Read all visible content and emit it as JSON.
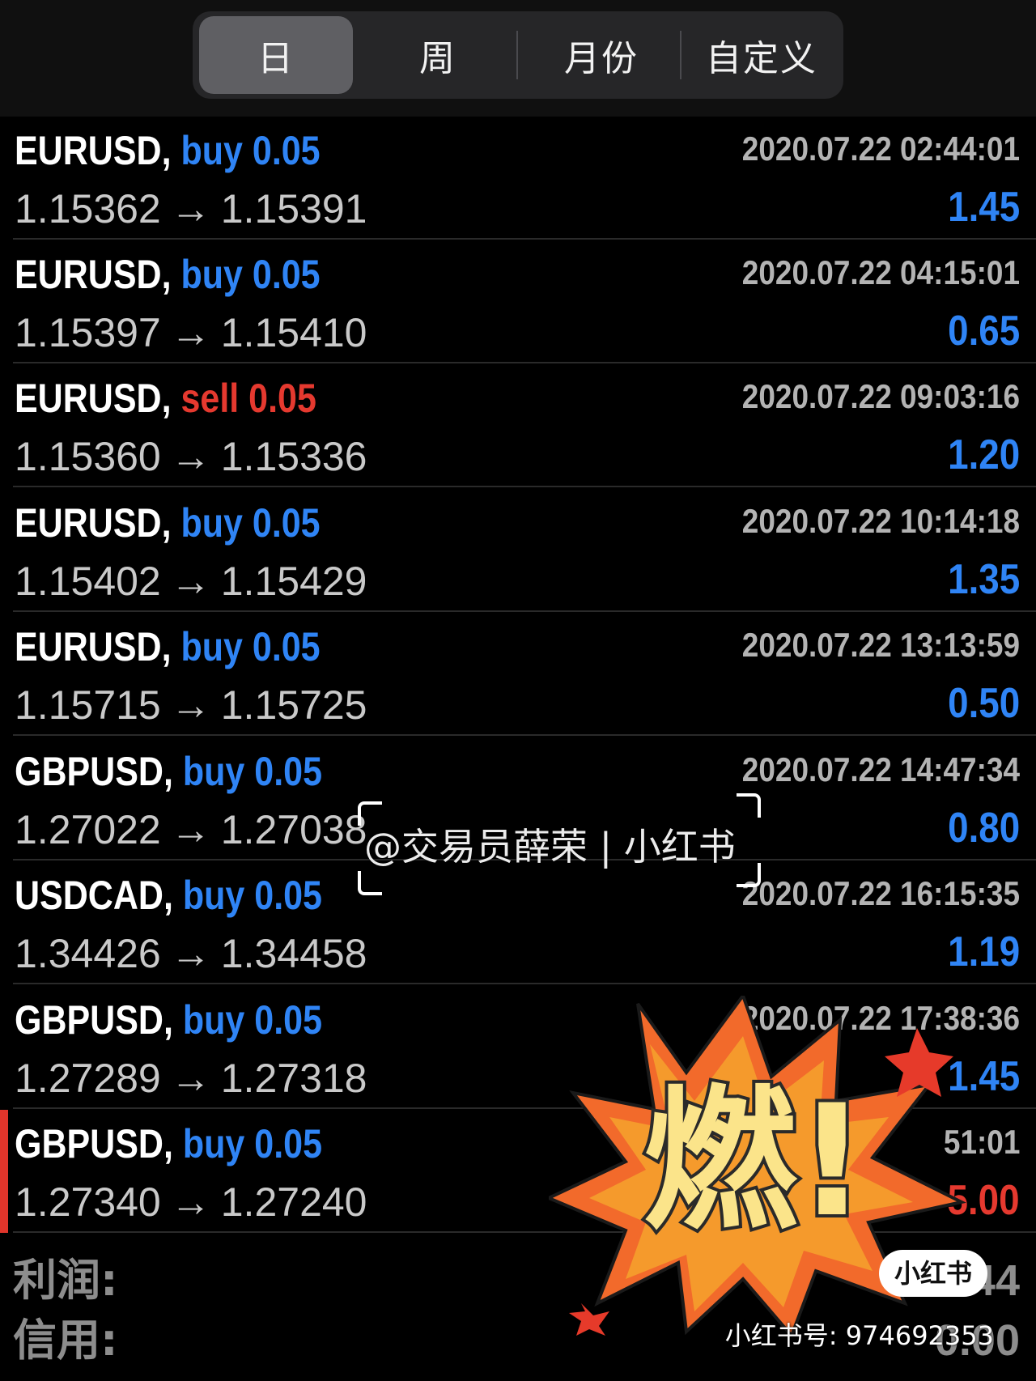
{
  "tabs": [
    {
      "label": "日",
      "active": true
    },
    {
      "label": "周",
      "active": false
    },
    {
      "label": "月份",
      "active": false
    },
    {
      "label": "自定义",
      "active": false
    }
  ],
  "trades": [
    {
      "symbol": "EURUSD",
      "side": "buy",
      "volume": "0.05",
      "open_price": "1.15362",
      "close_price": "1.15391",
      "time": "2020.07.22 02:44:01",
      "profit": "1.45"
    },
    {
      "symbol": "EURUSD",
      "side": "buy",
      "volume": "0.05",
      "open_price": "1.15397",
      "close_price": "1.15410",
      "time": "2020.07.22 04:15:01",
      "profit": "0.65"
    },
    {
      "symbol": "EURUSD",
      "side": "sell",
      "volume": "0.05",
      "open_price": "1.15360",
      "close_price": "1.15336",
      "time": "2020.07.22 09:03:16",
      "profit": "1.20"
    },
    {
      "symbol": "EURUSD",
      "side": "buy",
      "volume": "0.05",
      "open_price": "1.15402",
      "close_price": "1.15429",
      "time": "2020.07.22 10:14:18",
      "profit": "1.35"
    },
    {
      "symbol": "EURUSD",
      "side": "buy",
      "volume": "0.05",
      "open_price": "1.15715",
      "close_price": "1.15725",
      "time": "2020.07.22 13:13:59",
      "profit": "0.50"
    },
    {
      "symbol": "GBPUSD",
      "side": "buy",
      "volume": "0.05",
      "open_price": "1.27022",
      "close_price": "1.27038",
      "time": "2020.07.22 14:47:34",
      "profit": "0.80"
    },
    {
      "symbol": "USDCAD",
      "side": "buy",
      "volume": "0.05",
      "open_price": "1.34426",
      "close_price": "1.34458",
      "time": "2020.07.22 16:15:35",
      "profit": "1.19"
    },
    {
      "symbol": "GBPUSD",
      "side": "buy",
      "volume": "0.05",
      "open_price": "1.27289",
      "close_price": "1.27318",
      "time": "2020.07.22 17:38:36",
      "profit": "1.45"
    },
    {
      "symbol": "GBPUSD",
      "side": "buy",
      "volume": "0.05",
      "open_price": "1.27340",
      "close_price": "1.27240",
      "time": "51:01",
      "profit": "-5.00"
    }
  ],
  "summary": {
    "profit_label": "利润:",
    "profit_value": "44",
    "credit_label": "信用:",
    "credit_value": "0.00"
  },
  "overlay": {
    "watermark": "@交易员薛荣 | 小红书",
    "sticker_text": "燃!",
    "badge_text": "小红书",
    "account_id": "小红书号: 974692353"
  },
  "colors": {
    "buy": "#2f84f5",
    "sell": "#e5392f",
    "background": "#000000"
  }
}
